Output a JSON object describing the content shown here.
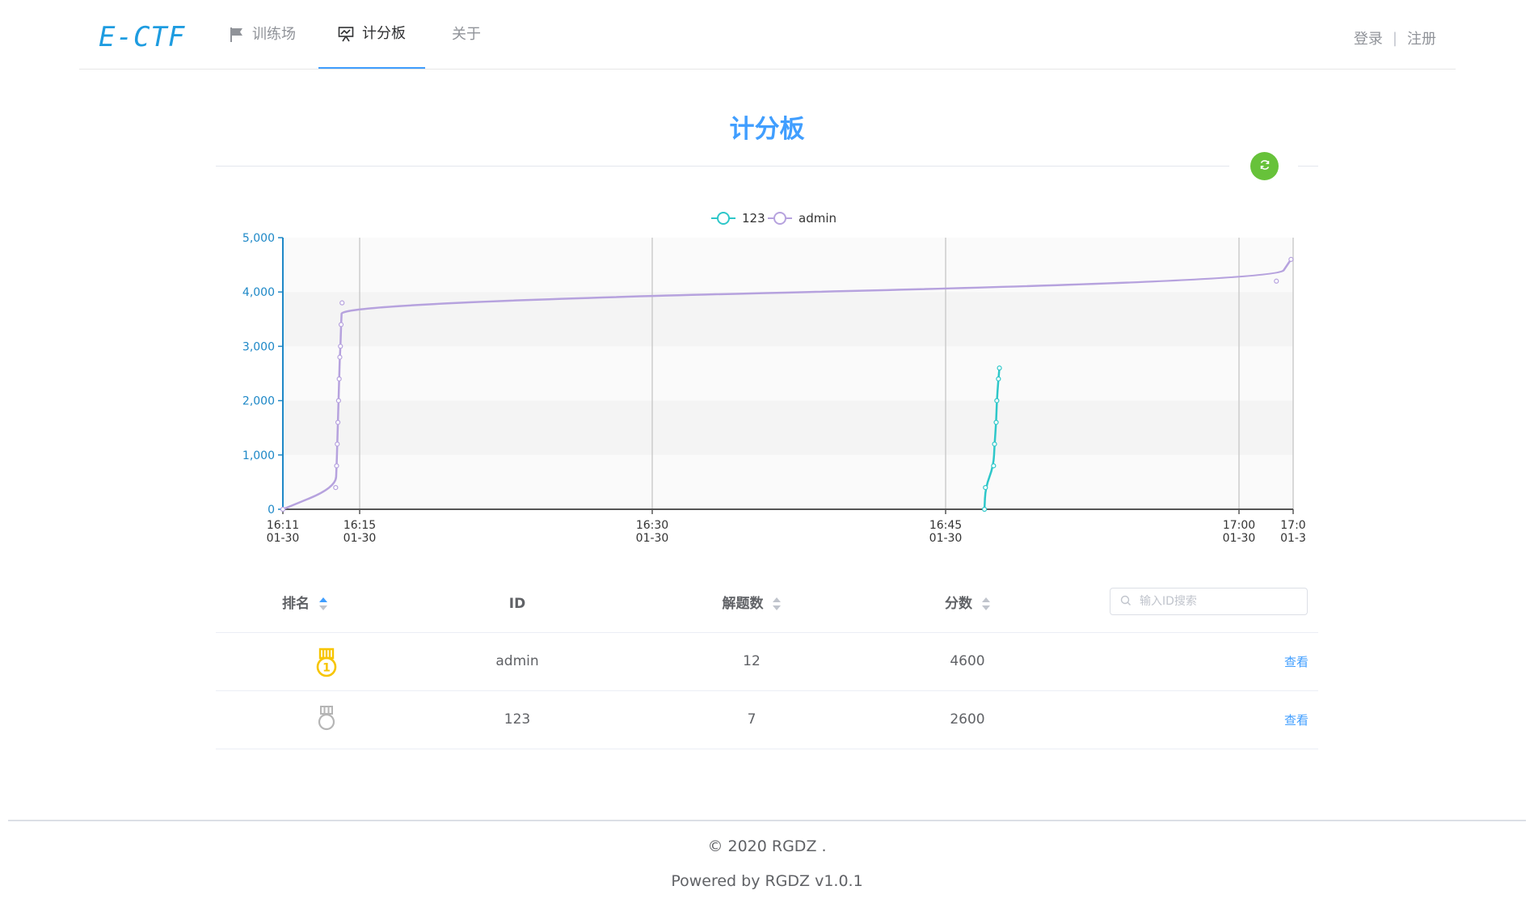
{
  "nav": {
    "logo": "E-CTF",
    "items": [
      {
        "label": "训练场",
        "icon": "flag-icon"
      },
      {
        "label": "计分板",
        "icon": "presentation-chart-icon"
      },
      {
        "label": "关于",
        "icon": ""
      }
    ],
    "active": "计分板",
    "login": "登录",
    "separator": "|",
    "register": "注册"
  },
  "page": {
    "title": "计分板",
    "refresh_icon": "refresh-icon"
  },
  "chart_data": {
    "type": "line",
    "legend": [
      "123",
      "admin"
    ],
    "legend_position": "top-center",
    "ylim": [
      0,
      5000
    ],
    "y_ticks": [
      "0",
      "1,000",
      "2,000",
      "3,000",
      "4,000",
      "5,000"
    ],
    "x_ticks": [
      {
        "time": "16:11",
        "date": "01-30"
      },
      {
        "time": "16:15",
        "date": "01-30"
      },
      {
        "time": "16:30",
        "date": "01-30"
      },
      {
        "time": "16:45",
        "date": "01-30"
      },
      {
        "time": "17:00",
        "date": "01-30"
      },
      {
        "time": "17:0",
        "date": "01-3"
      }
    ],
    "grid": true,
    "series": [
      {
        "name": "123",
        "color": "#2ec7c9",
        "points": [
          [
            "16:47:02",
            0
          ],
          [
            "16:47:05",
            400
          ],
          [
            "16:47:30",
            800
          ],
          [
            "16:47:33",
            1200
          ],
          [
            "16:47:38",
            1600
          ],
          [
            "16:47:40",
            2000
          ],
          [
            "16:47:45",
            2400
          ],
          [
            "16:47:48",
            2600
          ]
        ]
      },
      {
        "name": "admin",
        "color": "#b6a2de",
        "points": [
          [
            "16:11:00",
            0
          ],
          [
            "16:13:45",
            400
          ],
          [
            "16:13:48",
            800
          ],
          [
            "16:13:50",
            1200
          ],
          [
            "16:13:52",
            1600
          ],
          [
            "16:13:54",
            2000
          ],
          [
            "16:13:56",
            2400
          ],
          [
            "16:13:58",
            2800
          ],
          [
            "16:14:00",
            3000
          ],
          [
            "16:14:02",
            3400
          ],
          [
            "16:14:05",
            3800
          ],
          [
            "17:02:00",
            4200
          ],
          [
            "17:02:45",
            4600
          ]
        ]
      }
    ]
  },
  "table": {
    "headers": {
      "rank": "排名",
      "id": "ID",
      "solved": "解题数",
      "score": "分数"
    },
    "search_placeholder": "输入ID搜索",
    "rows": [
      {
        "rank_icon": "gold-medal-1-icon",
        "rank_color": "#f7c500",
        "id": "admin",
        "solved": "12",
        "score": "4600",
        "action": "查看"
      },
      {
        "rank_icon": "gray-medal-icon",
        "rank_color": "#b5b5b5",
        "id": "123",
        "solved": "7",
        "score": "2600",
        "action": "查看"
      }
    ]
  },
  "footer": {
    "copyright": "© 2020 RGDZ .",
    "powered": "Powered by RGDZ v1.0.1"
  }
}
